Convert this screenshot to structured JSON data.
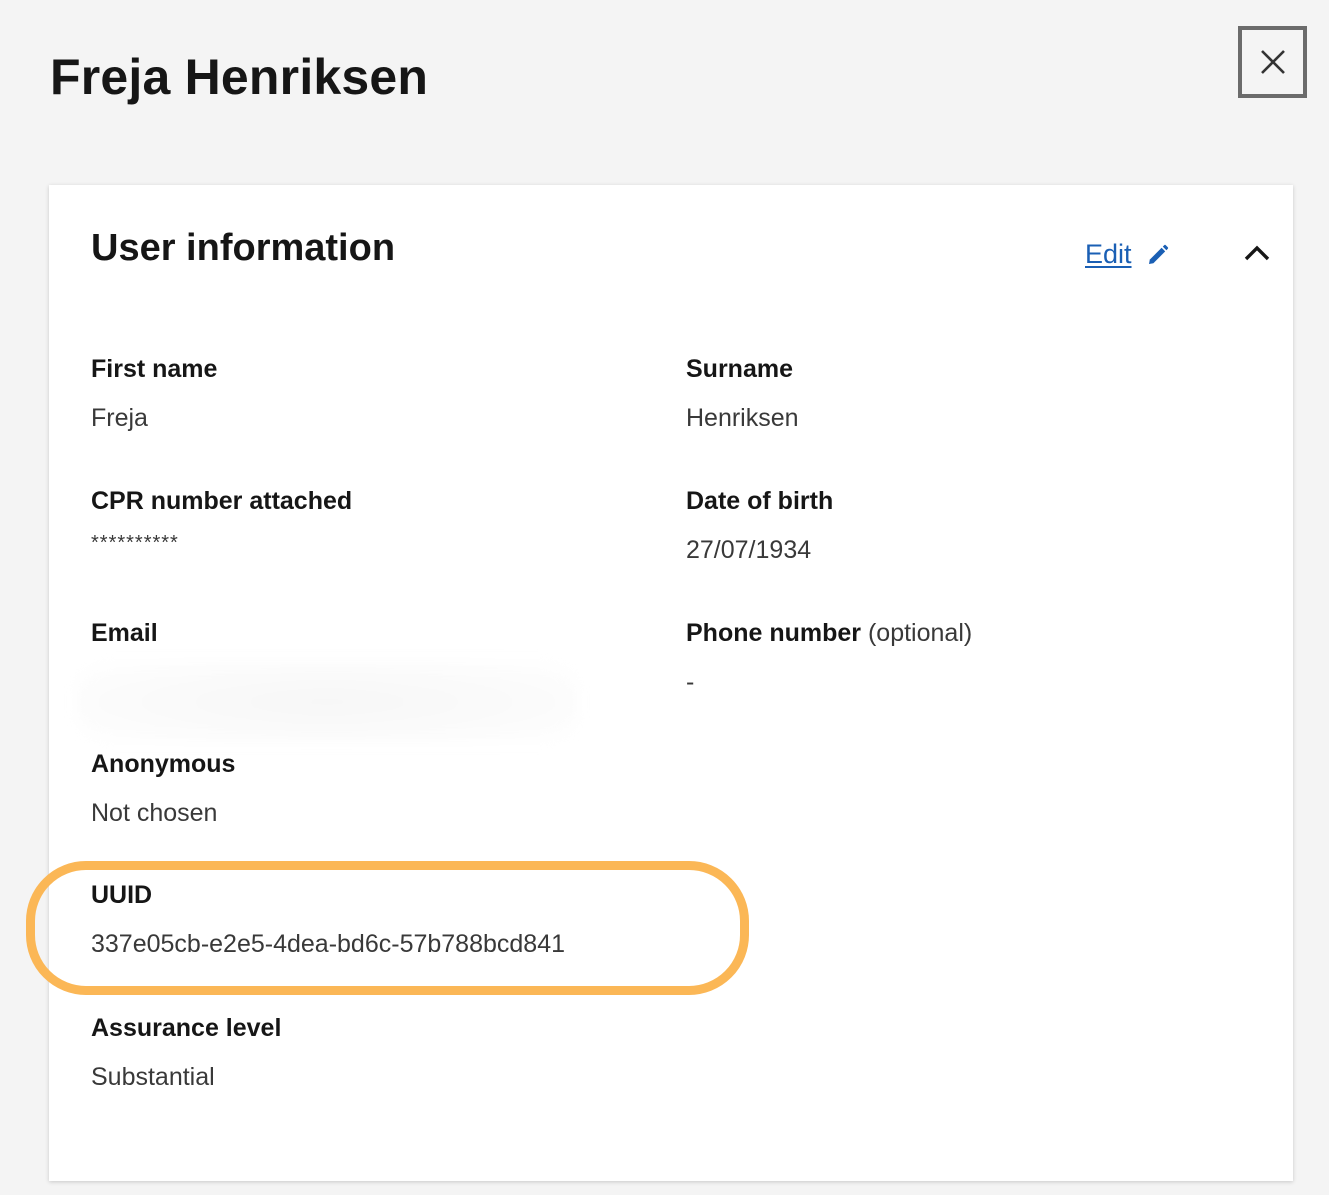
{
  "page": {
    "title": "Freja Henriksen",
    "close_icon": "close-icon"
  },
  "card": {
    "title": "User information",
    "edit_label": "Edit",
    "edit_icon": "pencil-icon",
    "collapse_icon": "chevron-up-icon",
    "fields": {
      "first_name": {
        "label": "First name",
        "value": "Freja"
      },
      "surname": {
        "label": "Surname",
        "value": "Henriksen"
      },
      "cpr": {
        "label": "CPR number attached",
        "value": "**********"
      },
      "dob": {
        "label": "Date of birth",
        "value": "27/07/1934"
      },
      "email": {
        "label": "Email",
        "value": ""
      },
      "phone": {
        "label": "Phone number",
        "optional": "(optional)",
        "value": "-"
      },
      "anonymous": {
        "label": "Anonymous",
        "value": "Not chosen"
      },
      "uuid": {
        "label": "UUID",
        "value": "337e05cb-e2e5-4dea-bd6c-57b788bcd841"
      },
      "assurance": {
        "label": "Assurance level",
        "value": "Substantial"
      }
    }
  },
  "colors": {
    "link": "#1a5fb4",
    "highlight": "#fbb756",
    "background": "#f4f4f4",
    "card": "#ffffff"
  }
}
